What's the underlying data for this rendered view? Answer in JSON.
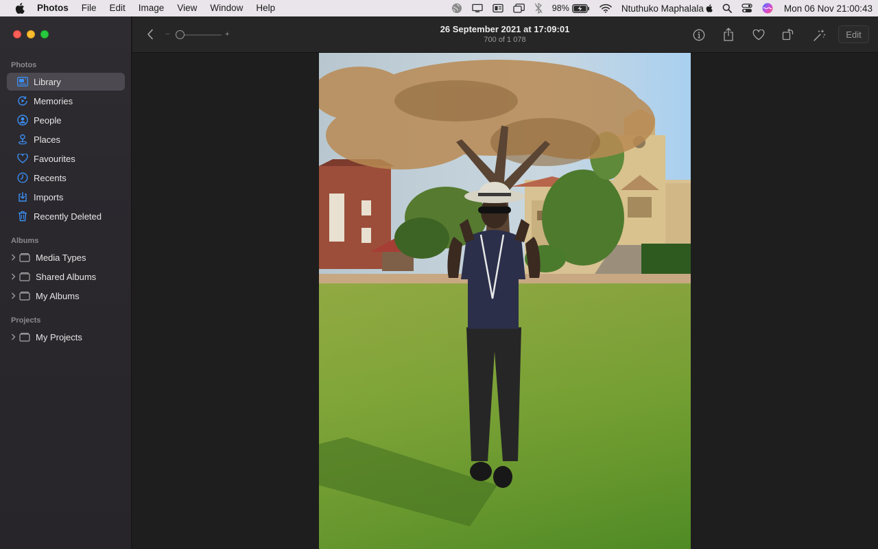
{
  "menubar": {
    "app_name": "Photos",
    "menus": [
      "File",
      "Edit",
      "Image",
      "View",
      "Window",
      "Help"
    ],
    "battery": "98%",
    "user": "Ntuthuko Maphalala",
    "clock": "Mon 06 Nov  21:00:43"
  },
  "sidebar": {
    "sections": {
      "photos": "Photos",
      "albums": "Albums",
      "projects": "Projects"
    },
    "items": [
      {
        "label": "Library",
        "icon": "library-icon",
        "selected": true
      },
      {
        "label": "Memories",
        "icon": "memories-icon"
      },
      {
        "label": "People",
        "icon": "people-icon"
      },
      {
        "label": "Places",
        "icon": "places-icon"
      },
      {
        "label": "Favourites",
        "icon": "heart-icon"
      },
      {
        "label": "Recents",
        "icon": "clock-icon"
      },
      {
        "label": "Imports",
        "icon": "import-icon"
      },
      {
        "label": "Recently Deleted",
        "icon": "trash-icon"
      }
    ],
    "albums": [
      {
        "label": "Media Types",
        "icon": "folder-icon"
      },
      {
        "label": "Shared Albums",
        "icon": "folder-icon"
      },
      {
        "label": "My Albums",
        "icon": "folder-icon"
      }
    ],
    "projects": [
      {
        "label": "My Projects",
        "icon": "folder-icon"
      }
    ]
  },
  "toolbar": {
    "zoom_minus": "−",
    "zoom_plus": "+",
    "zoom_level": 0,
    "title": "26 September 2021 at 17:09:01",
    "count": "700 of 1 078",
    "edit_label": "Edit"
  },
  "colors": {
    "accent": "#3b8ff5",
    "sidebar_selected": "#4c4a50",
    "window_bg": "#1e1e1e"
  }
}
